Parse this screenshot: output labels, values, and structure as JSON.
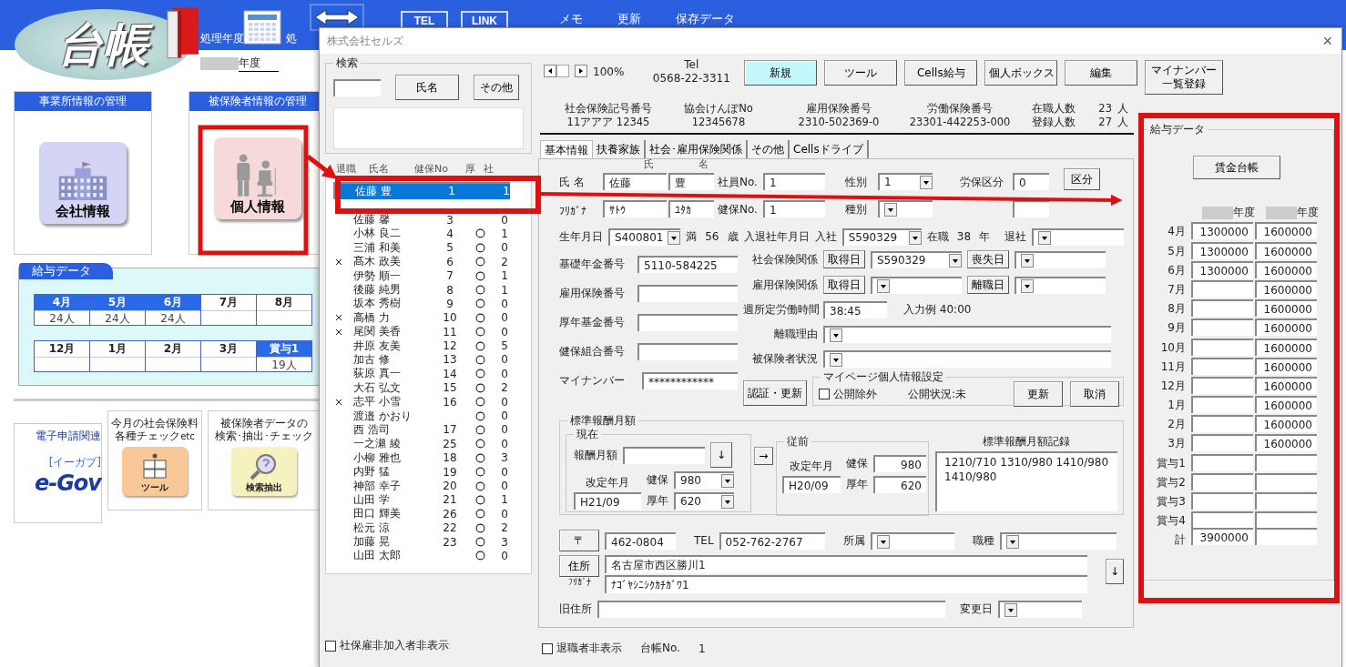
{
  "app": {
    "logo": "台帳",
    "fiscal_label": "処理年度",
    "fiscal_label_cut": "処",
    "fiscal_year": "年度",
    "toolbar_buttons": [
      {
        "label": "TEL"
      },
      {
        "label": "LINK"
      }
    ],
    "menu": [
      "メモ",
      "更新",
      "保存データ"
    ],
    "sections": [
      {
        "title": "事業所情報の管理",
        "button": "会社情報",
        "kind": "company"
      },
      {
        "title": "被保険者情報の管理",
        "button": "個人情報",
        "kind": "person"
      }
    ],
    "payroll": {
      "title": "給与データ",
      "rows": [
        [
          {
            "month": "4月",
            "active": true,
            "count": "24人"
          },
          {
            "month": "5月",
            "active": true,
            "count": "24人"
          },
          {
            "month": "6月",
            "active": true,
            "count": "24人"
          },
          {
            "month": "7月",
            "active": false
          },
          {
            "month": "8月",
            "active": false
          }
        ],
        [
          {
            "month": "12月",
            "active": false
          },
          {
            "month": "1月",
            "active": false
          },
          {
            "month": "2月",
            "active": false
          },
          {
            "month": "3月",
            "active": false
          },
          {
            "month": "賞与1",
            "active": true,
            "count": "19人"
          }
        ]
      ]
    },
    "cards": [
      {
        "kind": "egov",
        "caption": "電子申請関連",
        "logo": "e-Gov",
        "logo_note": "[イーガブ]"
      },
      {
        "kind": "tool",
        "caption": "今月の社会保険料",
        "caption_2": "各種チェック",
        "note": "etc",
        "label": "ツール"
      },
      {
        "kind": "search",
        "caption": "被保険者データの",
        "caption_2": "検索･抽出･チェック",
        "label": "検索抽出"
      }
    ]
  },
  "dialog": {
    "title": "株式会社セルズ",
    "close": "×",
    "search": {
      "legend": "検索",
      "buttons": [
        "氏名",
        "その他"
      ]
    },
    "list_columns": [
      "退職",
      "氏名",
      "健保No",
      "厚",
      "社"
    ],
    "employees": [
      {
        "retired": false,
        "name": "佐藤 豊",
        "no": "1",
        "kosei": false,
        "count": "1",
        "selected": true
      },
      {
        "retired": false,
        "name": "佐藤 馨",
        "no": "3",
        "kosei": false,
        "count": "0",
        "selected": false
      },
      {
        "retired": false,
        "name": "小林 良二",
        "no": "4",
        "kosei": true,
        "count": "1",
        "selected": false
      },
      {
        "retired": false,
        "name": "三浦 和美",
        "no": "5",
        "kosei": true,
        "count": "0",
        "selected": false
      },
      {
        "retired": true,
        "name": "髙木 政美",
        "no": "6",
        "kosei": true,
        "count": "2",
        "selected": false
      },
      {
        "retired": false,
        "name": "伊勢 順一",
        "no": "7",
        "kosei": true,
        "count": "1",
        "selected": false
      },
      {
        "retired": false,
        "name": "後藤 純男",
        "no": "8",
        "kosei": true,
        "count": "1",
        "selected": false
      },
      {
        "retired": false,
        "name": "坂本 秀樹",
        "no": "9",
        "kosei": true,
        "count": "0",
        "selected": false
      },
      {
        "retired": true,
        "name": "高橋 力",
        "no": "10",
        "kosei": true,
        "count": "0",
        "selected": false
      },
      {
        "retired": true,
        "name": "尾関 美香",
        "no": "11",
        "kosei": true,
        "count": "0",
        "selected": false
      },
      {
        "retired": false,
        "name": "井原 友美",
        "no": "12",
        "kosei": true,
        "count": "5",
        "selected": false
      },
      {
        "retired": false,
        "name": "加古 修",
        "no": "13",
        "kosei": true,
        "count": "0",
        "selected": false
      },
      {
        "retired": false,
        "name": "荻原 真一",
        "no": "14",
        "kosei": true,
        "count": "0",
        "selected": false
      },
      {
        "retired": false,
        "name": "大石 弘文",
        "no": "15",
        "kosei": true,
        "count": "2",
        "selected": false
      },
      {
        "retired": true,
        "name": "志平 小雪",
        "no": "16",
        "kosei": true,
        "count": "0",
        "selected": false
      },
      {
        "retired": false,
        "name": "渡邉 かおり",
        "kosei": true,
        "count": "0",
        "selected": false
      },
      {
        "retired": false,
        "name": "西 浩司",
        "no": "17",
        "kosei": true,
        "count": "0",
        "selected": false
      },
      {
        "retired": false,
        "name": "一之瀬 綾",
        "no": "25",
        "kosei": true,
        "count": "0",
        "selected": false
      },
      {
        "retired": false,
        "name": "小柳 雅也",
        "no": "18",
        "kosei": true,
        "count": "3",
        "selected": false
      },
      {
        "retired": false,
        "name": "内野 猛",
        "no": "19",
        "kosei": true,
        "count": "0",
        "selected": false
      },
      {
        "retired": false,
        "name": "神部 幸子",
        "no": "20",
        "kosei": true,
        "count": "0",
        "selected": false
      },
      {
        "retired": false,
        "name": "山田 学",
        "no": "21",
        "kosei": true,
        "count": "1",
        "selected": false
      },
      {
        "retired": false,
        "name": "田口 輝美",
        "no": "26",
        "kosei": true,
        "count": "0",
        "selected": false
      },
      {
        "retired": false,
        "name": "松元 涼",
        "no": "22",
        "kosei": true,
        "count": "2",
        "selected": false
      },
      {
        "retired": false,
        "name": "加藤 晃",
        "no": "23",
        "kosei": true,
        "count": "3",
        "selected": false
      },
      {
        "retired": false,
        "name": "山田 太郎",
        "kosei": true,
        "count": "0",
        "selected": false
      }
    ],
    "hide_uninsured": {
      "label": "社保雇非加入者非表示",
      "checked": false
    },
    "zoom": "100%",
    "tel_label": "Tel",
    "tel": "0568-22-3311",
    "buttons": [
      {
        "label": "新規",
        "highlighted": true
      },
      {
        "label": "ツール",
        "highlighted": false
      },
      {
        "label": "Cells給与",
        "highlighted": false
      },
      {
        "label": "個人ボックス",
        "highlighted": false
      },
      {
        "label": "編集",
        "highlighted": false
      },
      {
        "label": "マイナンバー",
        "label_2": "一覧登録",
        "highlighted": false
      }
    ],
    "info": [
      {
        "label": "社会保険記号番号",
        "value": "11アアア 12345"
      },
      {
        "label": "協会けんぽNo",
        "value": "12345678"
      },
      {
        "label": "雇用保険番号",
        "value": "2310-502369-0"
      },
      {
        "label": "労働保険番号",
        "value": "23301-442253-000"
      }
    ],
    "headcount": [
      {
        "label": "在職人数",
        "value": "23",
        "unit": "人"
      },
      {
        "label": "登録人数",
        "value": "27",
        "unit": "人"
      }
    ],
    "tabs": [
      {
        "label": "基本情報",
        "selected": true
      },
      {
        "label": "扶養家族",
        "selected": false
      },
      {
        "label": "社会･雇用保険関係",
        "selected": false
      },
      {
        "label": "その他",
        "selected": false
      },
      {
        "label": "Cellsドライブ",
        "selected": false
      }
    ],
    "form": {
      "last_head": "氏",
      "first_head": "名",
      "name_label": "氏 名",
      "last": "佐藤",
      "first": "豊",
      "kana_label": "ﾌﾘｶﾞﾅ",
      "last_kana": "ｻﾄｳ",
      "first_kana": "ﾕﾀｶ",
      "emp_no_label": "社員No.",
      "emp_no": "1",
      "health_no_label": "健保No.",
      "health_no": "1",
      "gender_label": "性別",
      "gender": "1",
      "type_label": "種別",
      "labor_label": "労保区分",
      "labor": "0",
      "category_button": "区分",
      "birth_label": "生年月日",
      "birth": "S400801",
      "age_prefix": "満",
      "age": "56",
      "age_unit": "歳",
      "tenure_label": "入退社年月日",
      "join_label": "入社",
      "join": "S590329",
      "service_label": "在職",
      "service": "38",
      "service_unit": "年",
      "leave_label": "退社",
      "pension_label": "基礎年金番号",
      "pension": "5110-584225",
      "emp_ins_label": "雇用保険番号",
      "fund_label": "厚年基金番号",
      "union_label": "健保組合番号",
      "mynumber_label": "マイナンバー",
      "mynumber": "************",
      "social_label": "社会保険関係",
      "social_get": "取得日",
      "social_date": "S590329",
      "social_lose": "喪失日",
      "employment_label": "雇用保険関係",
      "employment_get": "取得日",
      "employment_lose": "離職日",
      "hours_label": "週所定労働時間",
      "hours": "38:45",
      "hours_hint": "入力例  40:00",
      "reason_label": "離職理由",
      "status_label": "被保険者状況",
      "auth_button": "認証・更新",
      "mypage": {
        "legend": "マイページ個人情報設定",
        "exclude_label": "公開除外",
        "exclude": false,
        "status": "公開状況:未",
        "update": "更新",
        "cancel": "取消"
      },
      "std": {
        "legend": "標準報酬月額",
        "current": "現在",
        "monthly_label": "報酬月額",
        "down": "↓",
        "revised_label": "改定年月",
        "revised": "H21/09",
        "health_label": "健保",
        "health": "980",
        "pension_label": "厚年",
        "pension": "620",
        "copy": "→",
        "previous": "従前",
        "prev_revised_label": "改定年月",
        "prev_revised": "H20/09",
        "prev_health_label": "健保",
        "prev_health": "980",
        "prev_pension_label": "厚年",
        "prev_pension": "620",
        "record_label": "標準報酬月額記録",
        "record": "1210/710  1310/980 1410/980 1410/980"
      },
      "zip_button": "〒",
      "zip": "462-0804",
      "tel_label": "TEL",
      "tel": "052-762-2767",
      "dept_label": "所属",
      "job_label": "職種",
      "address_button": "住所",
      "address": "名古屋市西区勝川1",
      "address_kana_label": "ﾌﾘｶﾞﾅ",
      "address_kana": "ﾅｺﾞﾔｼﾆｼｸｶﾁｶﾞﾜ1",
      "address_down": "↓",
      "old_address_label": "旧住所",
      "changed_label": "変更日"
    },
    "hide_retired": {
      "label": "退職者非表示",
      "checked": false
    },
    "ledger_label": "台帳No.",
    "ledger_no": "1",
    "salary": {
      "legend": "給与データ",
      "button": "賃金台帳",
      "year_labels": [
        "年度",
        "年度"
      ],
      "rows": [
        {
          "label": "4月",
          "a": "1300000",
          "b": "1600000"
        },
        {
          "label": "5月",
          "a": "1300000",
          "b": "1600000"
        },
        {
          "label": "6月",
          "a": "1300000",
          "b": "1600000"
        },
        {
          "label": "7月",
          "b": "1600000"
        },
        {
          "label": "8月",
          "b": "1600000"
        },
        {
          "label": "9月",
          "b": "1600000"
        },
        {
          "label": "10月",
          "b": "1600000"
        },
        {
          "label": "11月",
          "b": "1600000"
        },
        {
          "label": "12月",
          "b": "1600000"
        },
        {
          "label": "1月",
          "b": "1600000"
        },
        {
          "label": "2月",
          "b": "1600000"
        },
        {
          "label": "3月",
          "b": "1600000"
        },
        {
          "label": "賞与1"
        },
        {
          "label": "賞与2"
        },
        {
          "label": "賞与3"
        },
        {
          "label": "賞与4"
        }
      ],
      "total_label": "計",
      "total_a": "3900000"
    }
  }
}
